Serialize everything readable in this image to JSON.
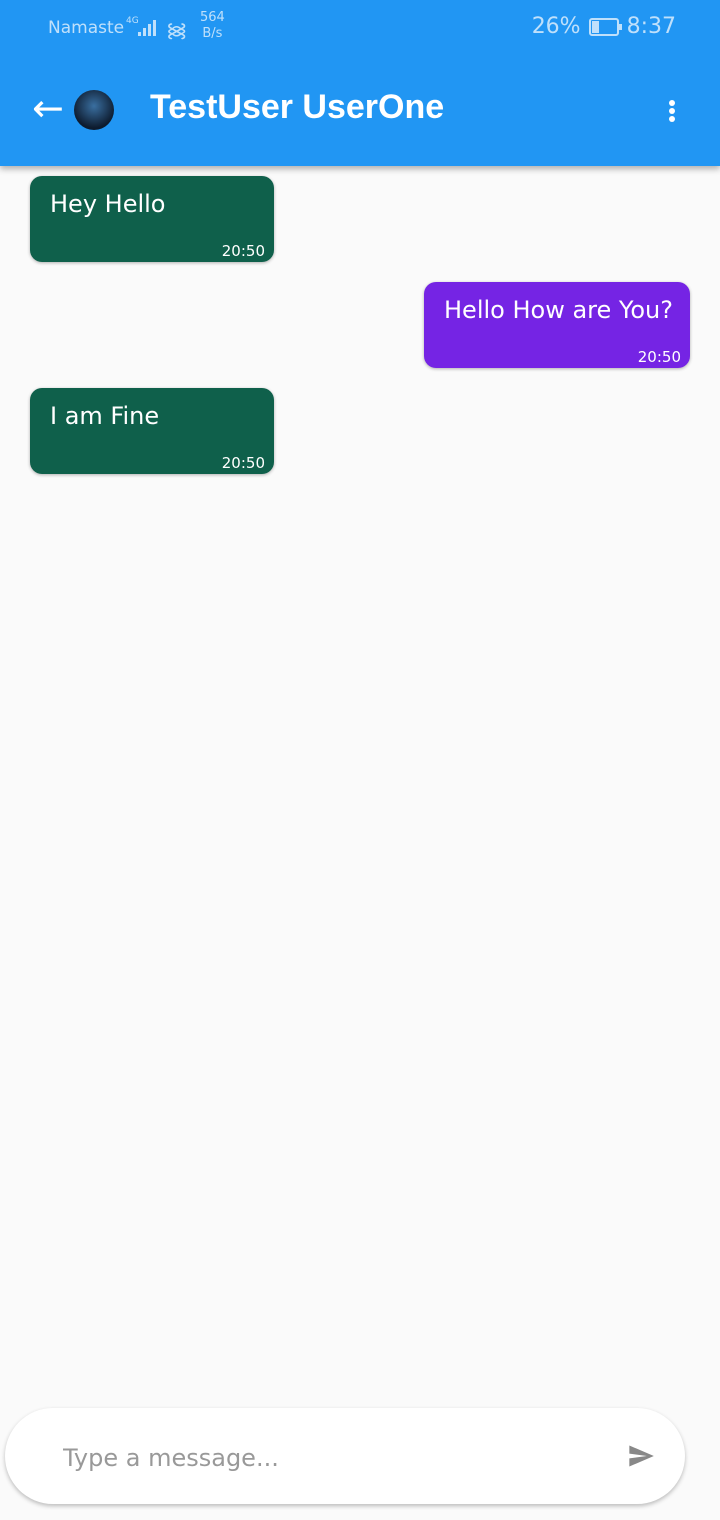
{
  "status": {
    "carrier": "Namaste",
    "network": "4G",
    "speed_value": "564",
    "speed_unit": "B/s",
    "battery": "26%",
    "time": "8:37"
  },
  "header": {
    "title": "TestUser UserOne",
    "back_icon": "arrow-back-icon",
    "menu_icon": "more-vert-icon"
  },
  "messages": [
    {
      "text": "Hey Hello",
      "time": "20:50",
      "direction": "incoming"
    },
    {
      "text": "Hello How are You?",
      "time": "20:50",
      "direction": "outgoing"
    },
    {
      "text": "I am Fine",
      "time": "20:50",
      "direction": "incoming"
    }
  ],
  "composer": {
    "placeholder": "Type a message...",
    "value": "",
    "send_icon": "send-icon"
  },
  "colors": {
    "appbar": "#2196f3",
    "incoming": "#0f604b",
    "outgoing": "#7524e4"
  }
}
